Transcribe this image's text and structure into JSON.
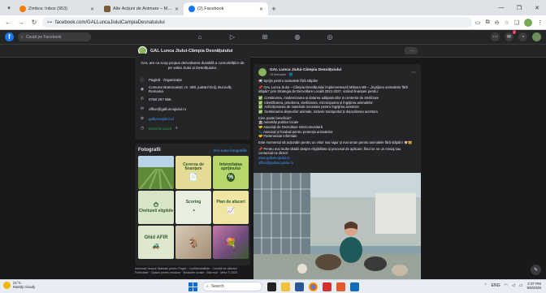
{
  "browser": {
    "tabs": [
      {
        "label": "Zimbra: Inbox (953)",
        "color": "#f57c00"
      },
      {
        "label": "Alte Acțiuni de Animare – Măsura 4.1…",
        "color": "#7a5c3a"
      },
      {
        "label": "(2) Facebook",
        "color": "#1877f2"
      }
    ],
    "new_tab": "+",
    "url": "facebook.com/GALLuncaJiuluiCampiaDesnatuiului"
  },
  "facebook": {
    "logo": "f",
    "search_placeholder": "Caută pe Facebook",
    "notif_badge": "2"
  },
  "page": {
    "name": "GAL Lunca Jiului-Câmpia Desnățuiului"
  },
  "intro": {
    "text": "GAL are ca scop propus dezvoltarea durabilă a comunităților de pe valea Jiului și Desnățuiului.",
    "rows": [
      {
        "icon": "info-icon",
        "glyph": "ⓘ",
        "text": "Pagină · Organizație",
        "link": false
      },
      {
        "icon": "location-icon",
        "glyph": "◉",
        "text": "Comuna Bratovoiești, nr. 389, județul Dolj, Bucovăț, Romania",
        "link": false
      },
      {
        "icon": "phone-icon",
        "glyph": "✆",
        "text": "0768 257 656",
        "link": false
      },
      {
        "icon": "mail-icon",
        "glyph": "✉",
        "text": "office@galluncajiului.ro",
        "link": false
      },
      {
        "icon": "web-icon",
        "glyph": "⊕",
        "text": "galluncajiului.ro",
        "link": true
      },
      {
        "icon": "open-icon",
        "glyph": "◷",
        "text": "Deschis acum",
        "link": false,
        "green": true
      }
    ]
  },
  "photos": {
    "title": "Fotografii",
    "see_all": "Vezi toate fotografiile",
    "tiles": [
      {
        "cap": "",
        "sub": "",
        "bg": "#5d7d3a",
        "fg": "#ffffff"
      },
      {
        "cap": "Cererea de finanțare",
        "sub": "",
        "bg": "#dcd58a",
        "fg": "#2f5a2a"
      },
      {
        "cap": "Intensitatea sprijinului",
        "sub": "",
        "bg": "#b7d66b",
        "fg": "#1f4a1f"
      },
      {
        "cap": "Cheltuieli eligibile",
        "sub": "",
        "bg": "#d8e4c8",
        "fg": "#2f5a2a"
      },
      {
        "cap": "Scoring",
        "sub": "",
        "bg": "#d8e4c8",
        "fg": "#2f5a2a"
      },
      {
        "cap": "Plan de afaceri",
        "sub": "",
        "bg": "#e7df9a",
        "fg": "#2f5a2a"
      },
      {
        "cap": "Ghid AFIR",
        "sub": "",
        "bg": "#d8e4c8",
        "fg": "#2f5a2a"
      },
      {
        "cap": "",
        "sub": "",
        "bg": "#c9b8a6",
        "fg": "#ffffff"
      },
      {
        "cap": "",
        "sub": "",
        "bg": "#8a6a88",
        "fg": "#ffffff"
      }
    ]
  },
  "footer": "Informații despre Statistici pentru Pagini · Confidențialitate · Condiții de utilizare · Publicitate · Opțiuni pentru reclame · Modulele cookie · Mai mult · Meta © 2025",
  "post": {
    "author": "GAL Lunca Jiului-Câmpia Desnățuiului",
    "date": "13 februarie · 🌐",
    "lines": [
      {
        "t": "📢 Sprijin pentru animalele fără stăpân!",
        "type": "p"
      },
      {
        "t": "📌 GAL Lunca Jiului – Câmpia Desnățuiului implementează Măsura M5 – „Îngrijirea animalelor fără stăpân” prin Strategia de Dezvoltare Locală 2021-2027, vizând finanțare pentru:",
        "type": "p"
      },
      {
        "t": "Construirea, modernizarea și dotarea adăposturilor și centrelor de sterilizare",
        "type": "chk"
      },
      {
        "t": "Identificarea, prinderea, sterilizarea, microciparea și îngrijirea animalelor",
        "type": "chk"
      },
      {
        "t": "Achiziționarea de materiale necesare pentru îngrijirea acestora",
        "type": "chk"
      },
      {
        "t": "Gestionarea deșeurilor animale, inclusiv transportul și depozitarea acestora",
        "type": "chk"
      },
      {
        "t": "Cine poate beneficia?",
        "type": "p"
      },
      {
        "t": "🏛 Autorități publice locale",
        "type": "p"
      },
      {
        "t": "🤝 Asociații de Dezvoltare Intercomunitară",
        "type": "p"
      },
      {
        "t": "🐾 Asociații și fundații pentru protecția animalelor",
        "type": "p"
      },
      {
        "t": "🤝 Parteneriate informale",
        "type": "p"
      },
      {
        "t": "Este momentul să acționăm pentru un viitor mai sigur și mai uman pentru animalele fără stăpân! 🐶🐱",
        "type": "p"
      },
      {
        "t": "📌 Pentru mai multe detalii despre eligibilitate și procesul de aplicare, fiind ne ne un mesaj sau contactați-ne direct!",
        "type": "p"
      },
      {
        "t": "www.galluncajiului.ro",
        "type": "link"
      },
      {
        "t": "office@galluncajiului.ro",
        "type": "link"
      }
    ]
  },
  "taskbar": {
    "weather_temp": "21°C",
    "weather_desc": "Mostly cloudy",
    "search_placeholder": "Search",
    "lang": "ENG",
    "time": "2:37 PM",
    "date": "5/6/2025"
  }
}
